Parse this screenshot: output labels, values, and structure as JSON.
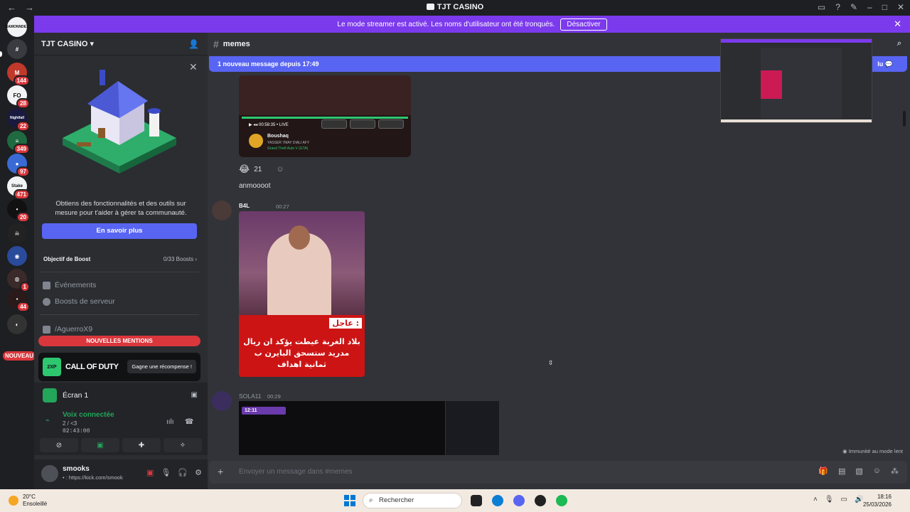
{
  "window": {
    "title": "TJT CASINO",
    "nav_back": "←",
    "nav_forward": "→",
    "controls": [
      "▭",
      "?",
      "✎",
      "–",
      "□",
      "✕"
    ]
  },
  "streamer_banner": {
    "text": "Le mode streamer est activé. Les noms d'utilisateur ont été tronqués.",
    "button": "Désactiver",
    "close": "✕"
  },
  "servers": [
    {
      "label": "RAMONNDEX",
      "color": "#f2f3f5",
      "badge": ""
    },
    {
      "label": "#",
      "color": "#3a3b40",
      "badge": ""
    },
    {
      "label": "M",
      "color": "#c0392b",
      "badge": "144"
    },
    {
      "label": "FO",
      "color": "#f2f3f5",
      "badge": "28"
    },
    {
      "label": "Nightfall",
      "color": "#1a1a40",
      "badge": "22"
    },
    {
      "label": "≡",
      "color": "#1f6a40",
      "badge": "349"
    },
    {
      "label": "●",
      "color": "#3a6ad4",
      "badge": "97"
    },
    {
      "label": "Stake",
      "color": "#f2f3f5",
      "badge": "471"
    },
    {
      "label": "•",
      "color": "#111",
      "badge": "20"
    },
    {
      "label": "☠",
      "color": "#222",
      "badge": ""
    },
    {
      "label": "◉",
      "color": "#2a4a9a",
      "badge": ""
    },
    {
      "label": "◍",
      "color": "#3a2a2a",
      "badge": "1"
    },
    {
      "label": "▪",
      "color": "#2a1a1a",
      "badge": "44"
    },
    {
      "label": "◐",
      "color": "#333",
      "badge": ""
    }
  ],
  "nouveau_label": "NOUVEAU",
  "sidebar": {
    "server_name": "TJT CASINO",
    "promo_text": "Obtiens des fonctionnalités et des outils sur mesure pour t'aider à gérer ta communauté.",
    "promo_button": "En savoir plus",
    "boost_label": "Objectif de Boost",
    "boost_count": "0/33 Boosts",
    "items": [
      {
        "label": "Événements"
      },
      {
        "label": "Boosts de serveur"
      }
    ],
    "channel": "/AguerroX9",
    "mentions": "NOUVELLES MENTIONS",
    "cod_name": "CALL OF DUTY",
    "cod_xp": "2XP",
    "cod_reward": "Gagne une récompense !",
    "voice": {
      "screen": "Écran 1",
      "status": "Voix connectée",
      "sub": "2 / <3",
      "time": "02:43:00"
    },
    "user": {
      "name": "smooks",
      "status": "• : https://kick.com/smook"
    }
  },
  "channel": {
    "name": "memes",
    "new_messages": "1 nouveau message depuis 17:49",
    "mark_read": "lu"
  },
  "messages": {
    "video1": {
      "channel_name": "Boushaq",
      "channel_desc": "YASSER 7MAY DIALI AFY",
      "game": "Grand Theft Auto V (GTA)",
      "time": "00:58:35",
      "live": "LIVE"
    },
    "reaction": {
      "emoji": "😂",
      "count": "21"
    },
    "text1": "anmoooot",
    "msg2": {
      "user": "B4L",
      "time": "00:27"
    },
    "photo": {
      "tag": "عاجل :",
      "caption": "بلاد الغربة عيطت يؤكد ان ريال مدريد ستسحق البايرن ب ثمانية اهداف"
    },
    "msg3": {
      "user": "SOLA11",
      "time": "00:29"
    },
    "video3": {
      "live": "12:11"
    }
  },
  "immunity": "Immunité au mode lent",
  "composer": {
    "placeholder": "Envoyer un message dans #memes"
  },
  "taskbar": {
    "temp": "20°C",
    "weather": "Ensoleillé",
    "search": "Rechercher",
    "time": "18:16",
    "date": "25/03/2026"
  }
}
